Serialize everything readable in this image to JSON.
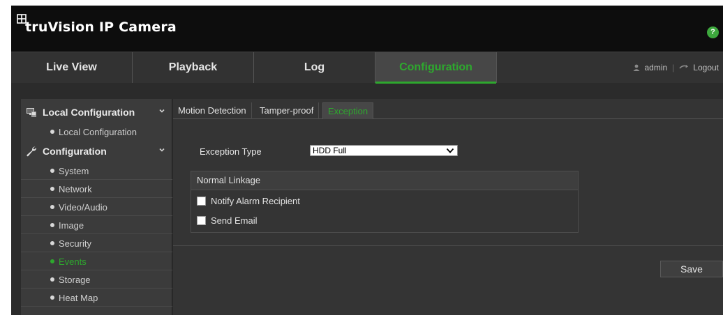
{
  "app": {
    "title": "truVision IP Camera"
  },
  "nav": {
    "tabs": [
      {
        "label": "Live View"
      },
      {
        "label": "Playback"
      },
      {
        "label": "Log"
      },
      {
        "label": "Configuration"
      }
    ],
    "active_tab": "Configuration",
    "user": "admin",
    "logout": "Logout"
  },
  "sidebar": {
    "sections": [
      {
        "label": "Local Configuration",
        "icon": "local-config-icon",
        "items": [
          {
            "label": "Local Configuration"
          }
        ]
      },
      {
        "label": "Configuration",
        "icon": "wrench-icon",
        "items": [
          {
            "label": "System"
          },
          {
            "label": "Network"
          },
          {
            "label": "Video/Audio"
          },
          {
            "label": "Image"
          },
          {
            "label": "Security"
          },
          {
            "label": "Events"
          },
          {
            "label": "Storage"
          },
          {
            "label": "Heat Map"
          }
        ]
      }
    ],
    "active_item": "Events"
  },
  "content": {
    "subtabs": [
      {
        "label": "Motion Detection"
      },
      {
        "label": "Tamper-proof"
      },
      {
        "label": "Exception"
      }
    ],
    "active_subtab": "Exception",
    "exception_type_label": "Exception Type",
    "exception_type_value": "HDD Full",
    "linkage": {
      "title": "Normal Linkage",
      "options": [
        {
          "label": "Notify Alarm Recipient",
          "checked": false
        },
        {
          "label": "Send Email",
          "checked": false
        }
      ]
    },
    "save_label": "Save"
  },
  "colors": {
    "accent": "#2ea82e",
    "header_bg": "#0d0d0d",
    "nav_bg": "#323232",
    "sidebar_bg": "#3b3b3b",
    "content_bg": "#343434"
  }
}
